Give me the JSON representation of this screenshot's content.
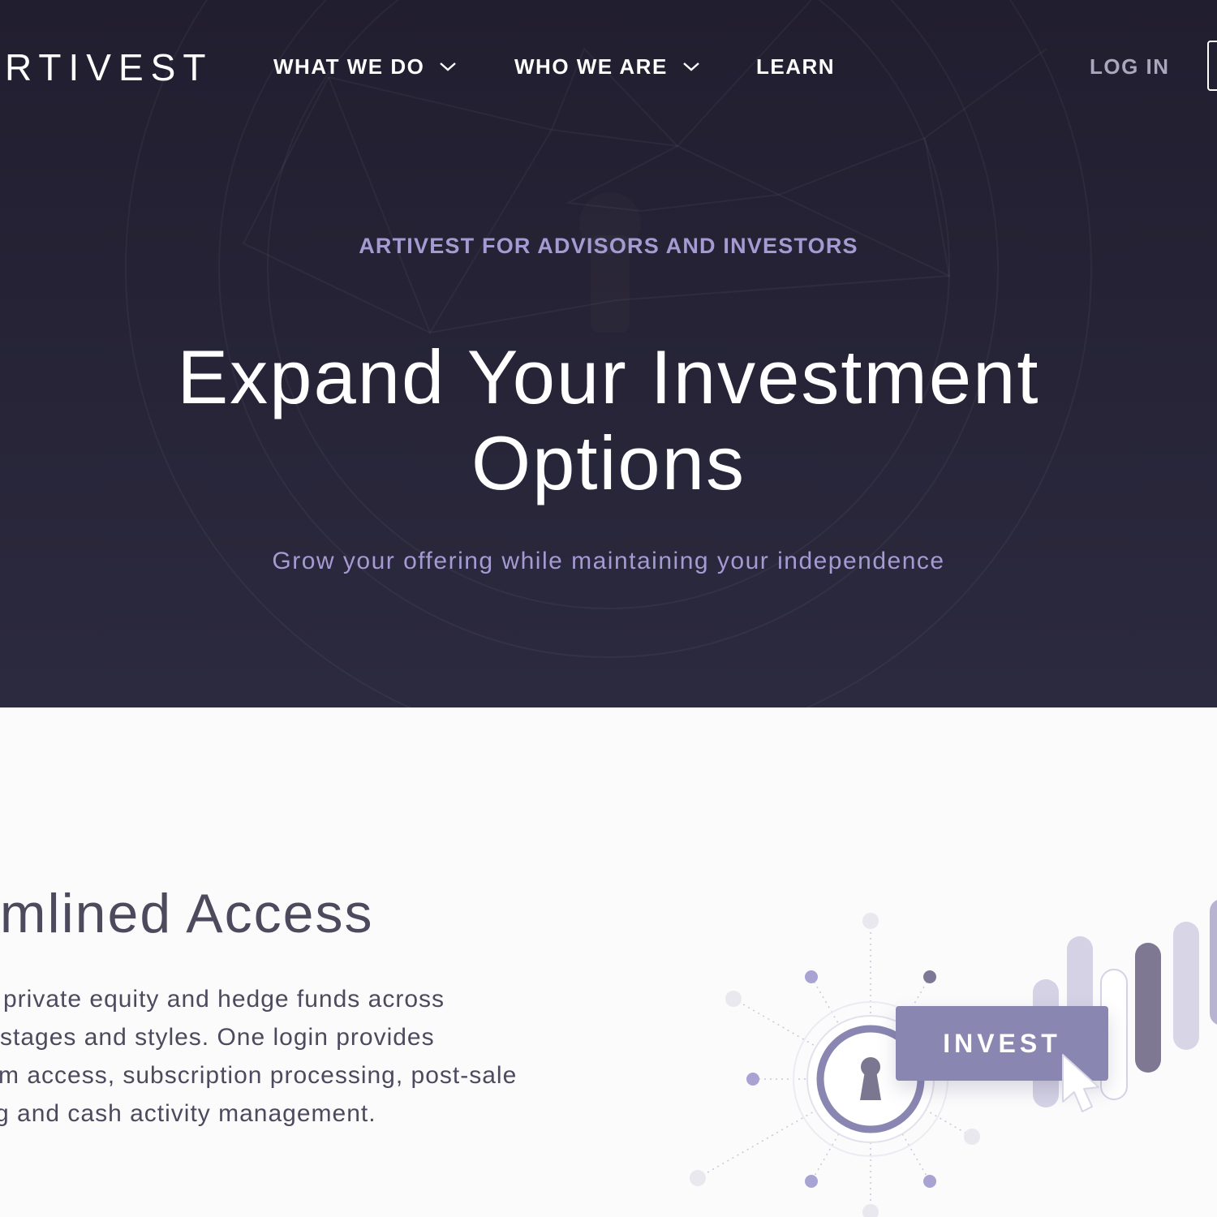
{
  "brand": {
    "logo_text": "RTIVEST"
  },
  "nav": {
    "items": [
      {
        "label": "WHAT WE DO",
        "has_dropdown": true,
        "icon": "chevron-down-icon"
      },
      {
        "label": "WHO WE ARE",
        "has_dropdown": true,
        "icon": "chevron-down-icon"
      },
      {
        "label": "LEARN",
        "has_dropdown": false
      }
    ],
    "login_label": "LOG IN"
  },
  "hero": {
    "eyebrow": "ARTIVEST FOR ADVISORS AND INVESTORS",
    "title_line1": "Expand Your Investment",
    "title_line2": "Options",
    "subtitle": "Grow your offering while maintaining your independence"
  },
  "section": {
    "title": "amlined Access",
    "body_lines": [
      "private equity and hedge funds across",
      "stages and styles. One login provides",
      "m access, subscription processing, post-sale",
      "g and cash activity management."
    ],
    "illustration": {
      "button_label": "INVEST",
      "icons": [
        "keyhole-lock-icon",
        "cursor-arrow-icon"
      ]
    }
  },
  "colors": {
    "hero_bg": "#262336",
    "accent_lavender": "#a69ad3",
    "button_purple": "#8a86b2",
    "body_text": "#4d4a5e"
  }
}
